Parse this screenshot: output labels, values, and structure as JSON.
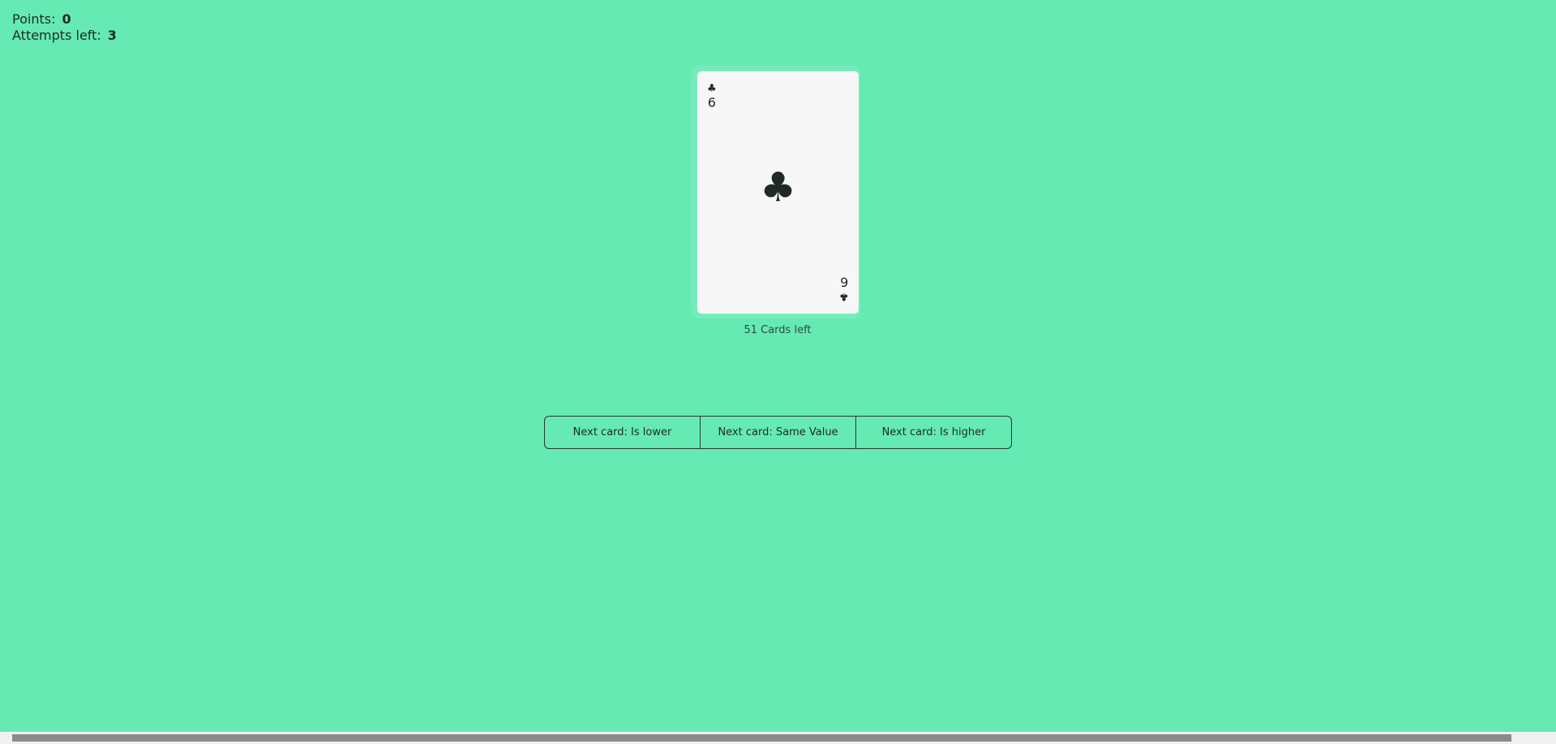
{
  "score": {
    "points_label": "Points:",
    "points_value": "0",
    "attempts_label": "Attempts left:",
    "attempts_value": "3"
  },
  "card": {
    "top_rank": "6",
    "bottom_rank": "9",
    "suit": "♣",
    "suit_name": "clubs-icon"
  },
  "deck": {
    "cards_left": "51 Cards left"
  },
  "guesses": {
    "lower": "Next card: Is lower",
    "same": "Next card: Same Value",
    "higher": "Next card: Is higher"
  },
  "colors": {
    "background": "#65eab3",
    "card": "#f7f7f7"
  }
}
